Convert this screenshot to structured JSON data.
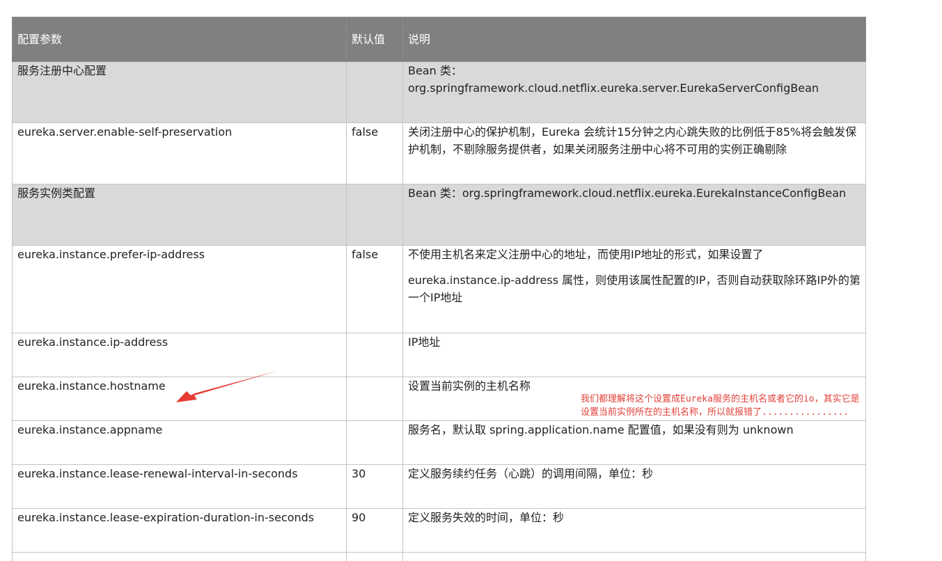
{
  "table": {
    "headers": [
      "配置参数",
      "默认值",
      "说明"
    ],
    "rows": [
      {
        "type": "section",
        "param": "服务注册中心配置",
        "default": "",
        "desc": [
          "Bean 类：org.springframework.cloud.netflix.eureka.server.EurekaServerConfigBean"
        ]
      },
      {
        "type": "row",
        "param": "eureka.server.enable-self-preservation",
        "default": "false",
        "desc": [
          "关闭注册中心的保护机制，Eureka 会统计15分钟之内心跳失败的比例低于85%将会触发保护机制，不剔除服务提供者，如果关闭服务注册中心将不可用的实例正确剔除"
        ]
      },
      {
        "type": "section",
        "param": "服务实例类配置",
        "default": "",
        "desc": [
          "Bean 类：org.springframework.cloud.netflix.eureka.EurekaInstanceConfigBean"
        ]
      },
      {
        "type": "row",
        "param": "eureka.instance.prefer-ip-address",
        "default": "false",
        "desc": [
          "不使用主机名来定义注册中心的地址，而使用IP地址的形式，如果设置了",
          "eureka.instance.ip-address 属性，则使用该属性配置的IP，否则自动获取除环路IP外的第一个IP地址"
        ]
      },
      {
        "type": "row",
        "param": "eureka.instance.ip-address",
        "default": "",
        "desc": [
          "IP地址"
        ]
      },
      {
        "type": "row",
        "param": "eureka.instance.hostname",
        "default": "",
        "desc": [
          "设置当前实例的主机名称"
        ]
      },
      {
        "type": "row",
        "param": "eureka.instance.appname",
        "default": "",
        "desc": [
          "服务名，默认取 spring.application.name 配置值，如果没有则为 unknown"
        ]
      },
      {
        "type": "row",
        "param": "eureka.instance.lease-renewal-interval-in-seconds",
        "default": "30",
        "desc": [
          "定义服务续约任务（心跳）的调用间隔，单位：秒"
        ]
      },
      {
        "type": "row",
        "param": "eureka.instance.lease-expiration-duration-in-seconds",
        "default": "90",
        "desc": [
          "定义服务失效的时间，单位：秒"
        ]
      },
      {
        "type": "row",
        "param": "",
        "default": "",
        "desc": [
          ""
        ]
      }
    ]
  },
  "annotation": {
    "text": "我们都理解将这个设置成Eureka服务的主机名或者它的io，其实它是设置当前实例所在的主机名称，所以就报错了................",
    "color": "#e2403a"
  },
  "colors": {
    "header_bg": "#808080",
    "section_bg": "#d9d9d9",
    "border": "#c4c4c4",
    "arrow": "#e83a32"
  }
}
